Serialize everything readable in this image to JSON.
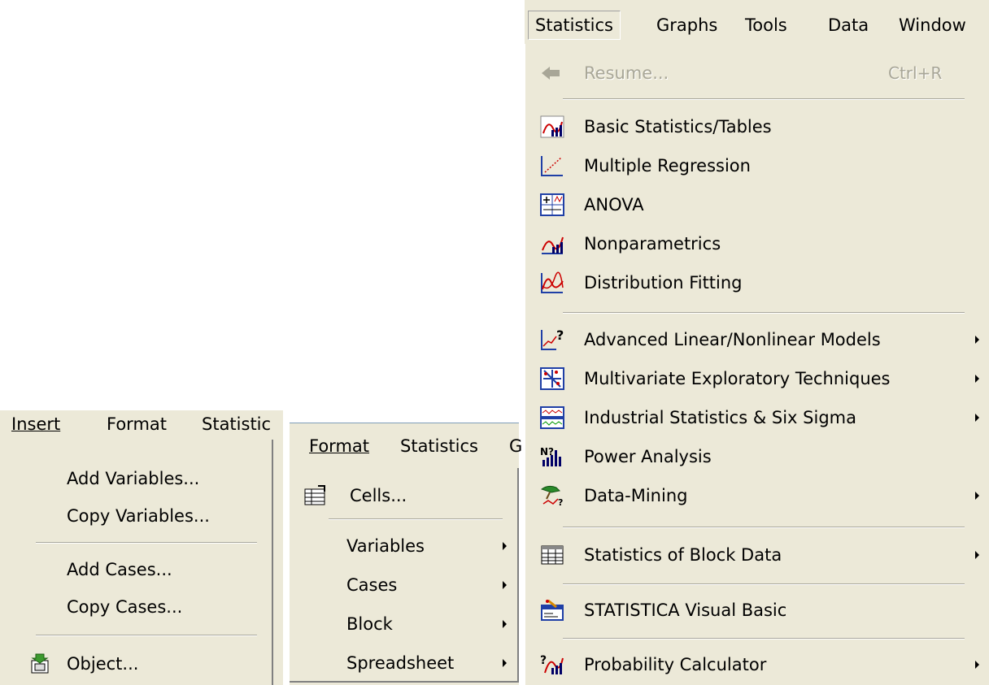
{
  "insert_panel": {
    "bar": [
      "Insert",
      "Format",
      "Statistic"
    ],
    "items": [
      "Add Variables...",
      "Copy Variables...",
      "Add Cases...",
      "Copy Cases...",
      "Object..."
    ]
  },
  "format_panel": {
    "bar": [
      "Format",
      "Statistics",
      "G"
    ],
    "items": [
      "Cells...",
      "Variables",
      "Cases",
      "Block",
      "Spreadsheet"
    ]
  },
  "statistics_panel": {
    "bar": [
      "Statistics",
      "Graphs",
      "Tools",
      "Data",
      "Window"
    ],
    "resume": "Resume...",
    "resume_shortcut": "Ctrl+R",
    "items": [
      "Basic Statistics/Tables",
      "Multiple Regression",
      "ANOVA",
      "Nonparametrics",
      "Distribution Fitting",
      "Advanced Linear/Nonlinear Models",
      "Multivariate Exploratory Techniques",
      "Industrial Statistics & Six Sigma",
      "Power Analysis",
      "Data-Mining",
      "Statistics of Block Data",
      "STATISTICA Visual Basic",
      "Probability Calculator"
    ]
  }
}
